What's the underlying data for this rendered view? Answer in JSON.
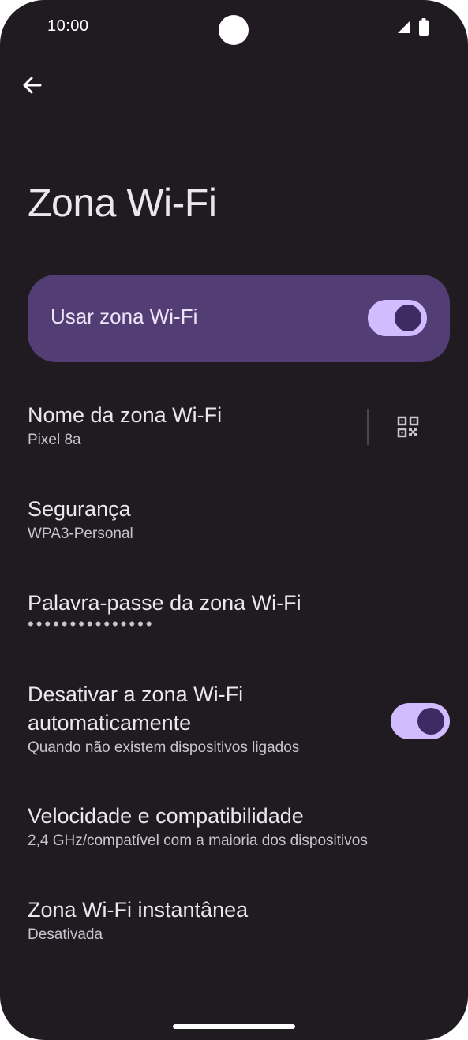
{
  "status_bar": {
    "time": "10:00"
  },
  "page": {
    "title": "Zona Wi-Fi"
  },
  "master_switch": {
    "label": "Usar zona Wi-Fi",
    "checked": true
  },
  "settings": {
    "hotspot_name": {
      "title": "Nome da zona Wi-Fi",
      "value": "Pixel 8a"
    },
    "security": {
      "title": "Segurança",
      "value": "WPA3-Personal"
    },
    "password": {
      "title": "Palavra-passe da zona Wi-Fi",
      "masked_value": "•••••••••••••••"
    },
    "auto_off": {
      "title_line1": "Desativar a zona Wi-Fi",
      "title_line2": "automaticamente",
      "summary": "Quando não existem dispositivos ligados",
      "checked": true
    },
    "speed": {
      "title": "Velocidade e compatibilidade",
      "value": "2,4 GHz/compatível com a maioria dos dispositivos"
    },
    "instant": {
      "title": "Zona Wi-Fi instantânea",
      "value": "Desativada"
    }
  },
  "icons": {
    "back": "arrow-back-icon",
    "qr": "qr-code-icon",
    "signal": "cell-signal-icon",
    "battery": "battery-icon"
  },
  "colors": {
    "background": "#1f1b21",
    "master_card": "#533d75",
    "toggle_track": "#d0bcfe",
    "toggle_thumb": "#3f2b63"
  }
}
